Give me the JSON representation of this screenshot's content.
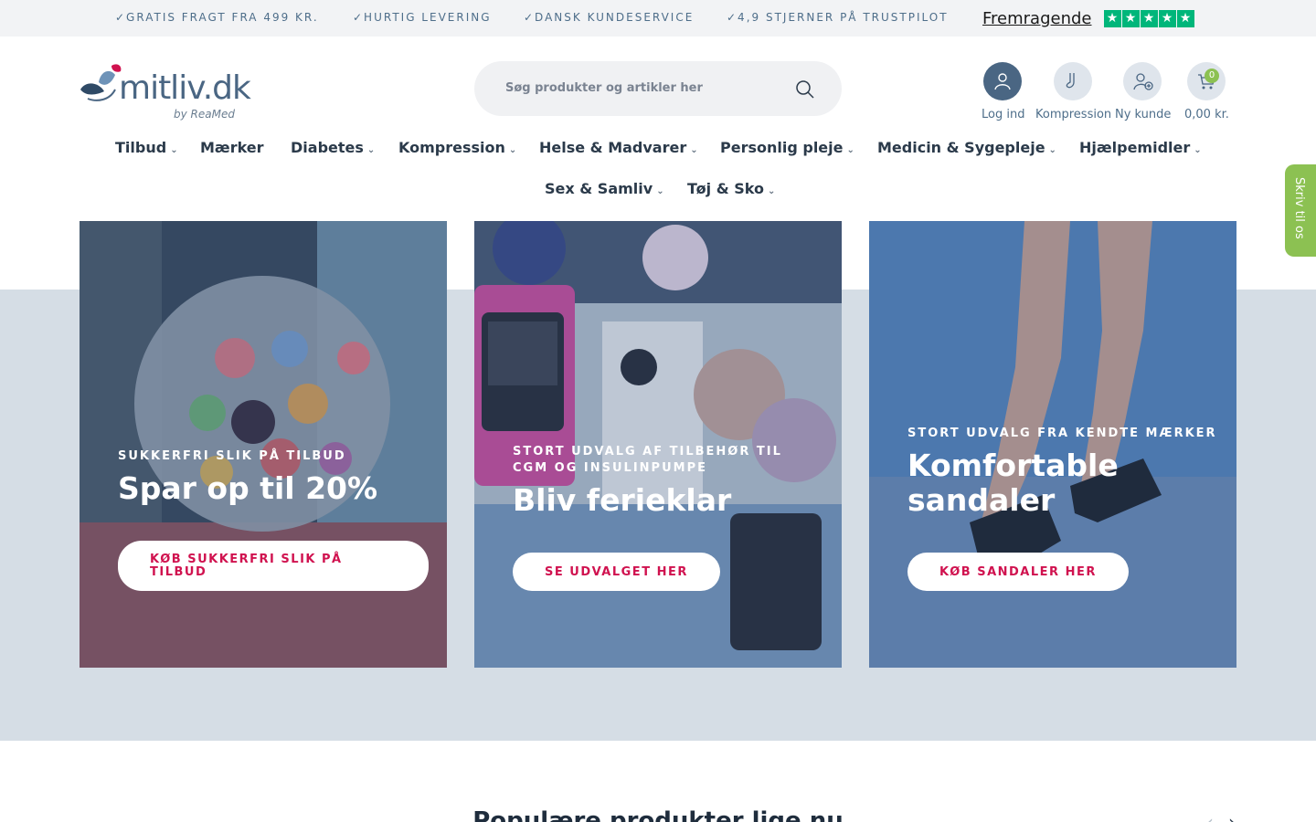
{
  "topbar": {
    "usps": [
      "✓GRATIS FRAGT FRA 499 KR.",
      "✓HURTIG LEVERING",
      "✓DANSK KUNDESERVICE",
      "✓4,9 STJERNER PÅ TRUSTPILOT"
    ],
    "trustpilot_word": "Fremragende",
    "trustpilot_star_color": "#00b67a"
  },
  "header": {
    "logo_text": "mitliv.dk",
    "logo_sub": "by ReaMed",
    "search_placeholder": "Søg produkter og artikler her",
    "icons": {
      "login": "user-icon",
      "compression": "sock-icon",
      "new_customer": "add-user-icon",
      "cart": "cart-icon"
    },
    "login_label": "Log ind",
    "compression_label": "Kompression",
    "new_customer_label": "Ny kunde",
    "cart_label": "0,00 kr.",
    "cart_count": "0"
  },
  "nav": {
    "items": [
      {
        "label": "Tilbud",
        "chevron": "⌄"
      },
      {
        "label": "Mærker",
        "chevron": ""
      },
      {
        "label": "Diabetes",
        "chevron": "⌄"
      },
      {
        "label": "Kompression",
        "chevron": "⌄"
      },
      {
        "label": "Helse & Madvarer",
        "chevron": "⌄"
      },
      {
        "label": "Personlig pleje",
        "chevron": "⌄"
      },
      {
        "label": "Medicin & Sygepleje",
        "chevron": "⌄"
      },
      {
        "label": "Hjælpemidler",
        "chevron": "⌄"
      },
      {
        "label": "Sex & Samliv",
        "chevron": "⌄"
      },
      {
        "label": "Tøj & Sko",
        "chevron": "⌄"
      }
    ]
  },
  "side_tab": {
    "label": "Skriv til os"
  },
  "hero": {
    "cards": [
      {
        "eyebrow": "SUKKERFRI SLIK PÅ TILBUD",
        "headline": "Spar op til 20%",
        "cta": "KØB SUKKERFRI SLIK PÅ TILBUD"
      },
      {
        "eyebrow": "STORT UDVALG AF TILBEHØR TIL CGM OG INSULINPUMPE",
        "headline": "Bliv ferieklar",
        "cta": "SE UDVALGET HER"
      },
      {
        "eyebrow": "STORT UDVALG FRA KENDTE MÆRKER",
        "headline": "Komfortable sandaler",
        "cta": "KØB SANDALER HER"
      }
    ]
  },
  "popular": {
    "title": "Populære produkter lige nu",
    "prev_arrow": "‹",
    "next_arrow": "›"
  },
  "colors": {
    "accent": "#d0124f",
    "brand": "#4a6683",
    "green": "#8cc152",
    "hero_band": "#d5dde5"
  }
}
